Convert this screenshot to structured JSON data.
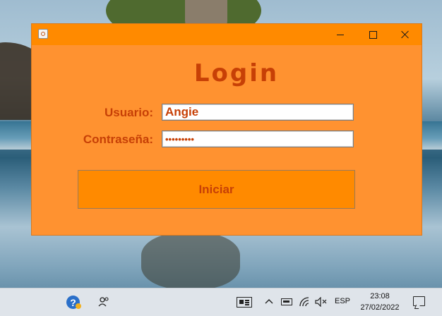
{
  "window": {
    "title": "",
    "heading": "Login",
    "fields": {
      "user_label": "Usuario:",
      "user_value": "Angie",
      "password_label": "Contraseña:",
      "password_value": "•••••••••"
    },
    "login_button": "Iniciar",
    "controls": {
      "minimize_icon": "minimize-icon",
      "maximize_icon": "maximize-icon",
      "close_icon": "close-icon"
    }
  },
  "taskbar": {
    "icons": [
      "help-icon",
      "people-icon",
      "news-icon",
      "chevron-up-icon",
      "battery-icon",
      "wifi-icon",
      "volume-muted-icon",
      "notification-icon"
    ],
    "help_glyph": "?",
    "language": "ESP",
    "time": "23:08",
    "date": "27/02/2022"
  },
  "colors": {
    "window_bg": "#ff9230",
    "titlebar": "#ff8a00",
    "text_accent": "#c74006",
    "button_bg": "#ff8a00",
    "taskbar_bg": "#dfe4ea"
  }
}
